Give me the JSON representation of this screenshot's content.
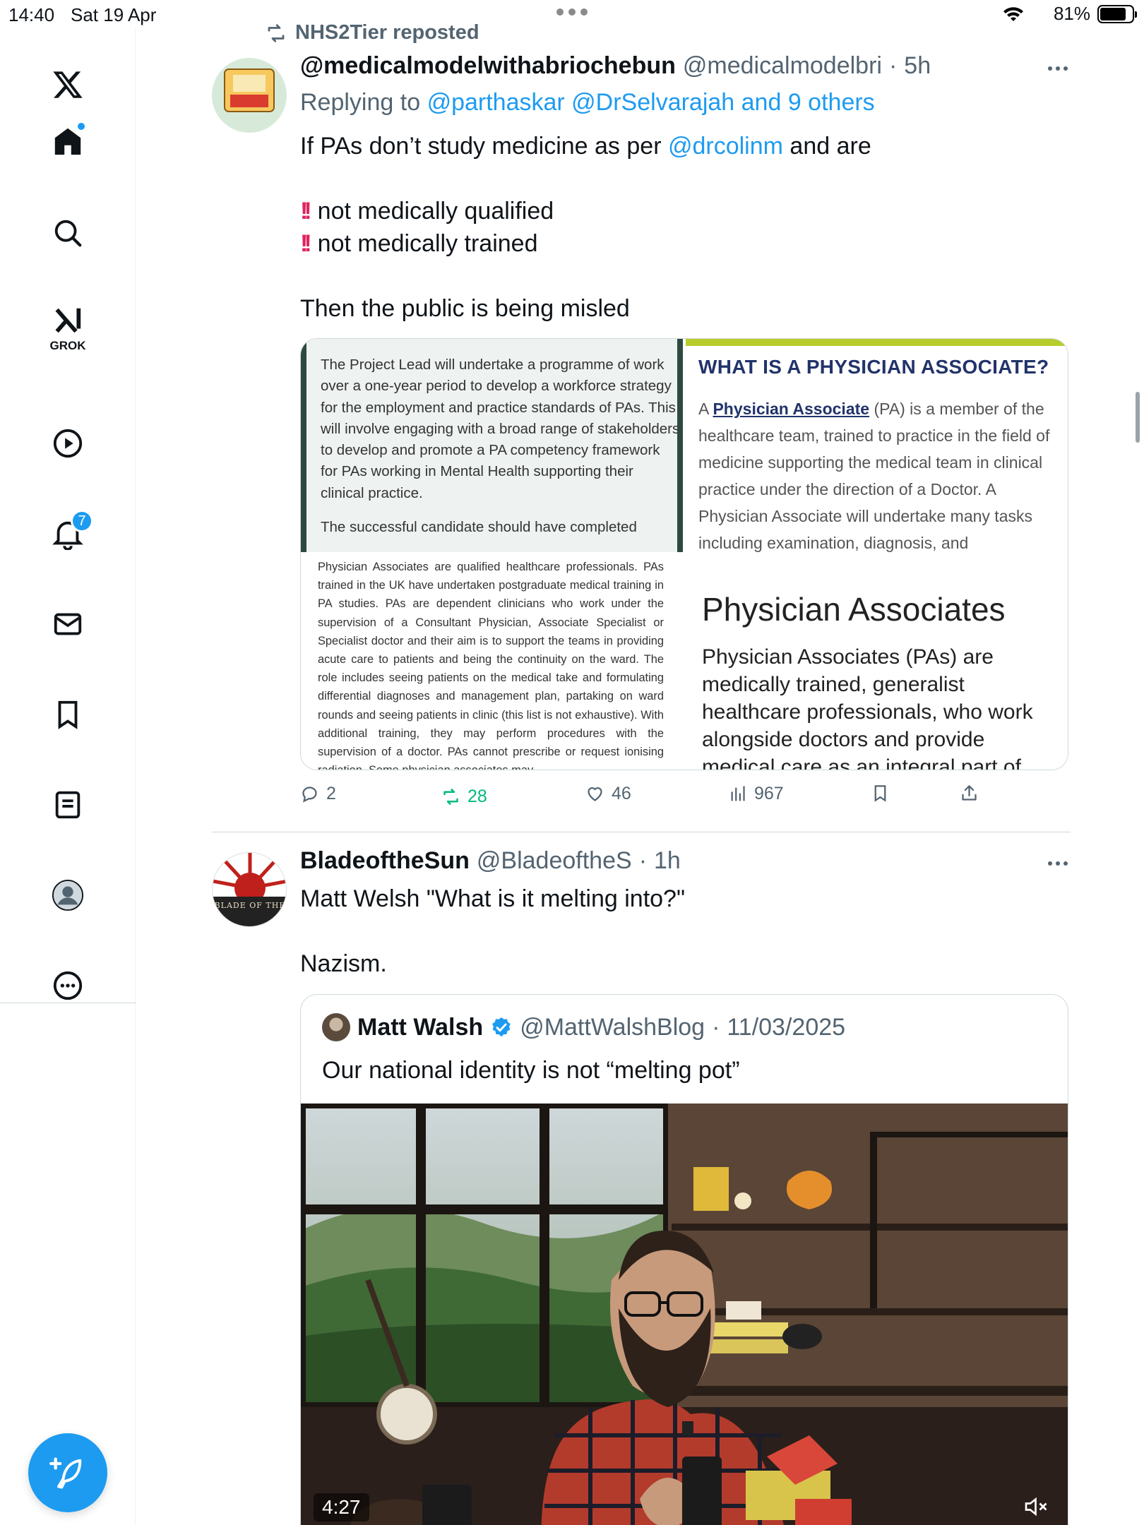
{
  "status_bar": {
    "time": "14:40",
    "date": "Sat 19 Apr",
    "battery": "81%",
    "battery_level": 0.81
  },
  "sidebar": {
    "items": [
      {
        "name": "home",
        "icon": "home-icon"
      },
      {
        "name": "explore",
        "icon": "search-icon"
      },
      {
        "name": "grok",
        "icon": "grok-icon",
        "label": "GROK"
      },
      {
        "name": "video",
        "icon": "play-icon"
      },
      {
        "name": "notifications",
        "icon": "bell-icon",
        "badge": "7"
      },
      {
        "name": "messages",
        "icon": "mail-icon"
      },
      {
        "name": "bookmarks",
        "icon": "bookmark-icon"
      },
      {
        "name": "lists",
        "icon": "list-icon"
      },
      {
        "name": "profile",
        "icon": "avatar"
      },
      {
        "name": "more",
        "icon": "more-icon"
      }
    ],
    "compose_icon": "compose-icon"
  },
  "feed": {
    "tweet1": {
      "repost_label": "NHS2Tier reposted",
      "name": "@medicalmodelwithabriochebun",
      "handle": "@medicalmodelbri",
      "time": "5h",
      "replying_prefix": "Replying to",
      "replying_to": "@parthaskar @DrSelvarajah and 9 others",
      "text_prefix": "If PAs don’t study medicine as per",
      "text_mention": "@drcolinm",
      "text_suffix": "and are",
      "bullet1": "not medically qualified",
      "bullet2": "not medically trained",
      "closing": "Then the public is being misled",
      "images": {
        "img1_text": "The Project Lead will undertake a programme of work over a one-year period to develop a workforce strategy for the employment and practice standards of PAs. This will involve engaging with a broad range of stakeholders to develop and promote a PA competency framework for PAs working in Mental Health supporting their clinical practice.",
        "img1_cut": "The successful candidate should have completed",
        "img2_title": "WHAT IS A PHYSICIAN ASSOCIATE?",
        "img2_a": "A",
        "img2_link": "Physician Associate",
        "img2_text": "(PA) is a member of the healthcare team, trained to practice in the field of medicine supporting the medical team in clinical practice under the direction of a Doctor. A Physician Associate will undertake many tasks including examination, diagnosis, and",
        "img3_text": "Physician Associates are qualified healthcare professionals. PAs trained in the UK have undertaken postgraduate medical training in PA studies. PAs are dependent clinicians who work under the supervision of a Consultant Physician, Associate Specialist or Specialist doctor and their aim is to support the teams in providing acute care to patients and being the continuity on the ward. The role includes seeing patients on the medical take and formulating differential diagnoses and management plan, partaking on ward rounds and seeing patients in clinic (this list is not exhaustive). With additional training, they may perform procedures with the supervision of a doctor. PAs cannot prescribe or request ionising radiation. Some physician associates may",
        "img4_title": "Physician Associates",
        "img4_text": "Physician Associates (PAs) are medically trained, generalist healthcare professionals, who work alongside doctors and provide medical care as an integral part of"
      },
      "replies": "2",
      "reposts": "28",
      "likes": "46",
      "views": "967"
    },
    "tweet2": {
      "name": "BladeoftheSun",
      "handle": "@BladeoftheS",
      "time": "1h",
      "text1": "Matt Welsh \"What is it melting into?\"",
      "text2": "Nazism.",
      "avatar_text": "BLADE OF THE",
      "quote": {
        "name": "Matt Walsh",
        "handle": "@MattWalshBlog",
        "date": "11/03/2025",
        "text": "Our national identity is not “melting pot”",
        "video_duration": "4:27"
      }
    }
  },
  "colors": {
    "accent": "#1d9bf0",
    "repost_green": "#00ba7c",
    "muted": "#536471"
  }
}
